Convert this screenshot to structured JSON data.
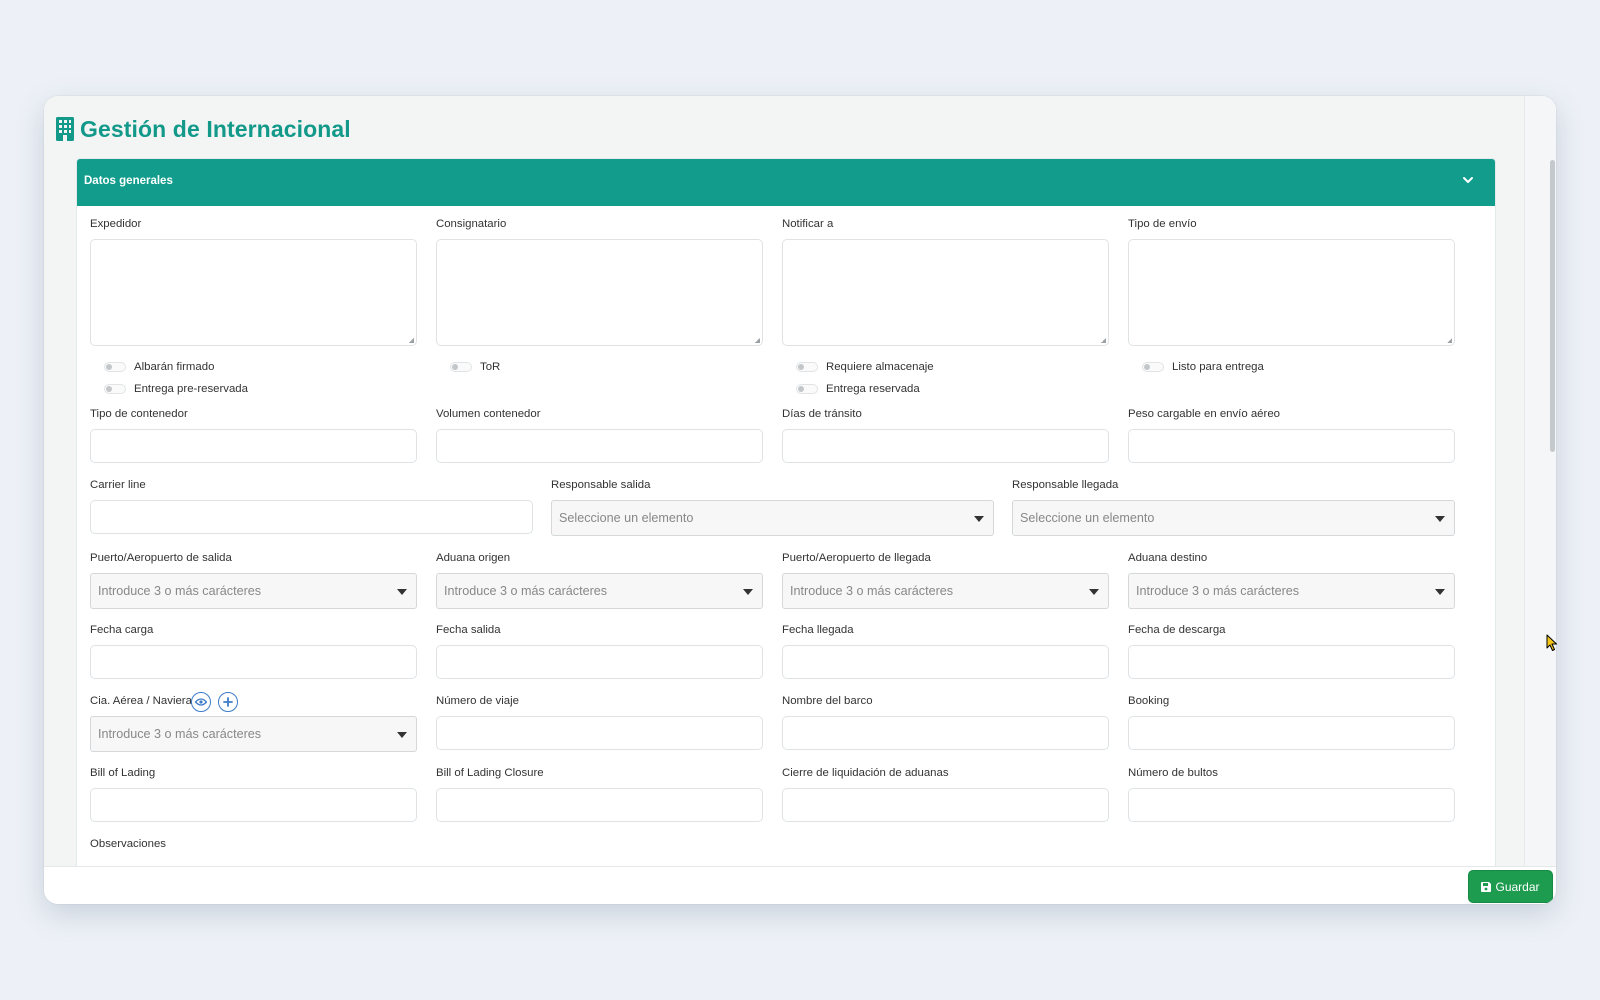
{
  "page": {
    "title": "Gestión de Internacional",
    "title_icon": "building-icon",
    "accent_color": "#119c8c",
    "save_color": "#1d9b4f"
  },
  "panel": {
    "title": "Datos generales",
    "collapse_icon": "chevron-down-icon"
  },
  "row1": {
    "expedidor": "Expedidor",
    "consignatario": "Consignatario",
    "notificar": "Notificar a",
    "tipo_envio": "Tipo de envío"
  },
  "toggles": {
    "albaran": "Albarán firmado",
    "entrega_pre": "Entrega pre-reservada",
    "tor": "ToR",
    "requiere_alm": "Requiere almacenaje",
    "entrega_res": "Entrega reservada",
    "listo": "Listo para entrega"
  },
  "row2": {
    "tipo_contenedor": "Tipo de contenedor",
    "volumen": "Volumen contenedor",
    "dias": "Días de tránsito",
    "peso": "Peso cargable en envío aéreo"
  },
  "row3": {
    "carrier": "Carrier line",
    "resp_salida": "Responsable salida",
    "resp_llegada": "Responsable llegada",
    "select_placeholder": "Seleccione un elemento"
  },
  "row4": {
    "puerto_salida": "Puerto/Aeropuerto de salida",
    "aduana_origen": "Aduana origen",
    "puerto_llegada": "Puerto/Aeropuerto de llegada",
    "aduana_destino": "Aduana destino",
    "search_placeholder": "Introduce 3 o más carácteres"
  },
  "row5": {
    "fecha_carga": "Fecha carga",
    "fecha_salida": "Fecha salida",
    "fecha_llegada": "Fecha llegada",
    "fecha_descarga": "Fecha de descarga"
  },
  "row6": {
    "cia": "Cia. Aérea / Naviera",
    "numero_viaje": "Número de viaje",
    "nombre_barco": "Nombre del barco",
    "booking": "Booking",
    "search_placeholder": "Introduce 3 o más carácteres"
  },
  "row7": {
    "bill": "Bill of Lading",
    "bill_closure": "Bill of Lading Closure",
    "cierre": "Cierre de liquidación de aduanas",
    "bultos": "Número de bultos"
  },
  "observaciones": "Observaciones",
  "footer": {
    "save_label": "Guardar",
    "save_icon": "floppy-disk-icon"
  }
}
